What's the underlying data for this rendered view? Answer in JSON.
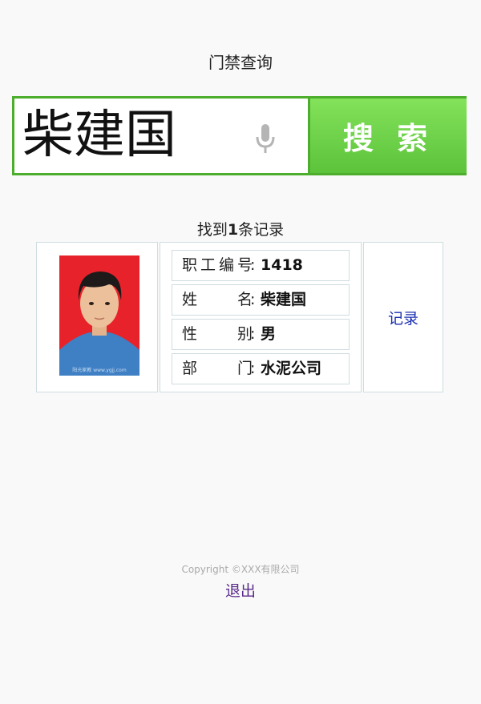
{
  "header": {
    "title": "门禁查询"
  },
  "search": {
    "value": "柴建国",
    "mic_icon": "microphone-icon",
    "button_label": "搜 索",
    "accent_color": "#5cc33b",
    "border_color": "#4cae2c"
  },
  "results": {
    "count_prefix": "找到",
    "count": "1",
    "count_suffix": "条记录"
  },
  "record": {
    "photo_watermark": "阳光家教 www.ygjj.com",
    "fields": [
      {
        "label": "职工编号",
        "value": "1418"
      },
      {
        "label": "姓名",
        "value": "柴建国"
      },
      {
        "label": "性别",
        "value": "男"
      },
      {
        "label": "部门",
        "value": "水泥公司"
      }
    ],
    "action_label": "记录"
  },
  "footer": {
    "copyright": "Copyright ©XXX有限公司",
    "logout_label": "退出"
  }
}
